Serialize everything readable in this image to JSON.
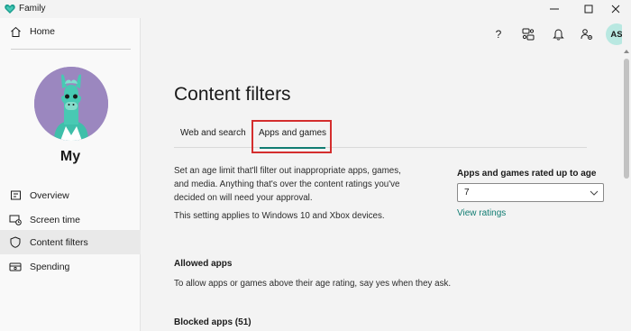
{
  "window": {
    "title": "Family",
    "logo_icon": "family-heart-icon",
    "controls": [
      "minimize-icon",
      "maximize-icon",
      "close-icon"
    ]
  },
  "sidebar": {
    "home_label": "Home",
    "profile_name": "My",
    "items": [
      {
        "label": "Overview",
        "icon": "overview-icon",
        "active": false
      },
      {
        "label": "Screen time",
        "icon": "screen-time-icon",
        "active": false
      },
      {
        "label": "Content filters",
        "icon": "shield-icon",
        "active": true
      },
      {
        "label": "Spending",
        "icon": "spending-icon",
        "active": false
      }
    ]
  },
  "header": {
    "help": "?",
    "user_initials": "AS",
    "icons": [
      "help-icon",
      "family-group-icon",
      "notification-bell-icon",
      "manage-people-icon"
    ]
  },
  "main": {
    "title": "Content filters",
    "tabs": [
      {
        "label": "Web and search",
        "active": false
      },
      {
        "label": "Apps and games",
        "active": true
      }
    ],
    "description": "Set an age limit that'll filter out inappropriate apps, games, and media. Anything that's over the content ratings you've decided on will need your approval.",
    "applies_to": "This setting applies to Windows 10 and Xbox devices.",
    "age_limit": {
      "label": "Apps and games rated up to age",
      "value": "7",
      "view_ratings": "View ratings"
    },
    "allowed_apps": {
      "title": "Allowed apps",
      "description": "To allow apps or games above their age rating, say yes when they ask."
    },
    "blocked_apps": {
      "title": "Blocked apps (51)"
    }
  },
  "colors": {
    "accent": "#107c72",
    "highlight": "#d42e2e",
    "avatar_bg": "#9b87bf",
    "user_avatar_bg": "#b9e8e1"
  }
}
